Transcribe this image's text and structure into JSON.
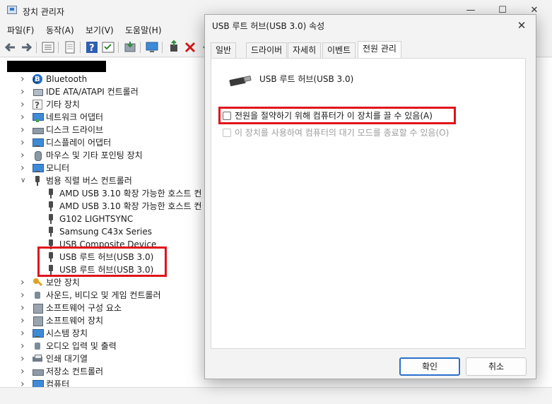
{
  "device_manager": {
    "title": "장치 관리자",
    "menu": [
      "파일(F)",
      "동작(A)",
      "보기(V)",
      "도움말(H)"
    ],
    "tree": [
      {
        "label": "Bluetooth",
        "icon": "bluetooth-icon",
        "level": 1
      },
      {
        "label": "IDE ATA/ATAPI 컨트롤러",
        "icon": "ide-controller-icon",
        "level": 1
      },
      {
        "label": "기타 장치",
        "icon": "unknown-device-icon",
        "level": 1
      },
      {
        "label": "네트워크 어댑터",
        "icon": "network-adapter-icon",
        "level": 1
      },
      {
        "label": "디스크 드라이브",
        "icon": "disk-drive-icon",
        "level": 1
      },
      {
        "label": "디스플레이 어댑터",
        "icon": "display-adapter-icon",
        "level": 1
      },
      {
        "label": "마우스 및 기타 포인팅 장치",
        "icon": "mouse-icon",
        "level": 1
      },
      {
        "label": "모니터",
        "icon": "monitor-icon",
        "level": 1
      },
      {
        "label": "범용 직렬 버스 컨트롤러",
        "icon": "usb-controller-icon",
        "level": 1,
        "expanded": true
      },
      {
        "label": "AMD USB 3.10 확장 가능한 호스트 컨",
        "icon": "usb-icon",
        "level": 2
      },
      {
        "label": "AMD USB 3.10 확장 가능한 호스트 컨",
        "icon": "usb-icon",
        "level": 2
      },
      {
        "label": "G102 LIGHTSYNC",
        "icon": "usb-icon",
        "level": 2
      },
      {
        "label": "Samsung C43x Series",
        "icon": "usb-icon",
        "level": 2
      },
      {
        "label": "USB Composite Device",
        "icon": "usb-icon",
        "level": 2
      },
      {
        "label": "USB 루트 허브(USB 3.0)",
        "icon": "usb-icon",
        "level": 2
      },
      {
        "label": "USB 루트 허브(USB 3.0)",
        "icon": "usb-icon",
        "level": 2
      },
      {
        "label": "보안 장치",
        "icon": "security-key-icon",
        "level": 1
      },
      {
        "label": "사운드, 비디오 및 게임 컨트롤러",
        "icon": "sound-icon",
        "level": 1
      },
      {
        "label": "소프트웨어 구성 요소",
        "icon": "software-component-icon",
        "level": 1
      },
      {
        "label": "소프트웨어 장치",
        "icon": "software-device-icon",
        "level": 1
      },
      {
        "label": "시스템 장치",
        "icon": "system-device-icon",
        "level": 1
      },
      {
        "label": "오디오 입력 및 출력",
        "icon": "audio-io-icon",
        "level": 1
      },
      {
        "label": "인쇄 대기열",
        "icon": "printer-icon",
        "level": 1
      },
      {
        "label": "저장소 컨트롤러",
        "icon": "storage-controller-icon",
        "level": 1
      },
      {
        "label": "컴퓨터",
        "icon": "computer-icon",
        "level": 1
      }
    ]
  },
  "dialog": {
    "title": "USB 루트 허브(USB 3.0) 속성",
    "tabs": [
      "일반",
      "드라이버",
      "자세히",
      "이벤트",
      "전원 관리"
    ],
    "active_tab": "전원 관리",
    "device_name": "USB 루트 허브(USB 3.0)",
    "options": [
      {
        "label": "전원을 절약하기 위해 컴퓨터가 이 장치를 끌 수 있음(A)",
        "checked": false,
        "enabled": true
      },
      {
        "label": "이 장치를 사용하여 컴퓨터의 대기 모드를 종료할 수 있음(O)",
        "checked": false,
        "enabled": false
      }
    ],
    "ok_label": "확인",
    "cancel_label": "취소"
  },
  "colors": {
    "highlight": "#e0141b",
    "primary_button_border": "#2a6fc9"
  }
}
